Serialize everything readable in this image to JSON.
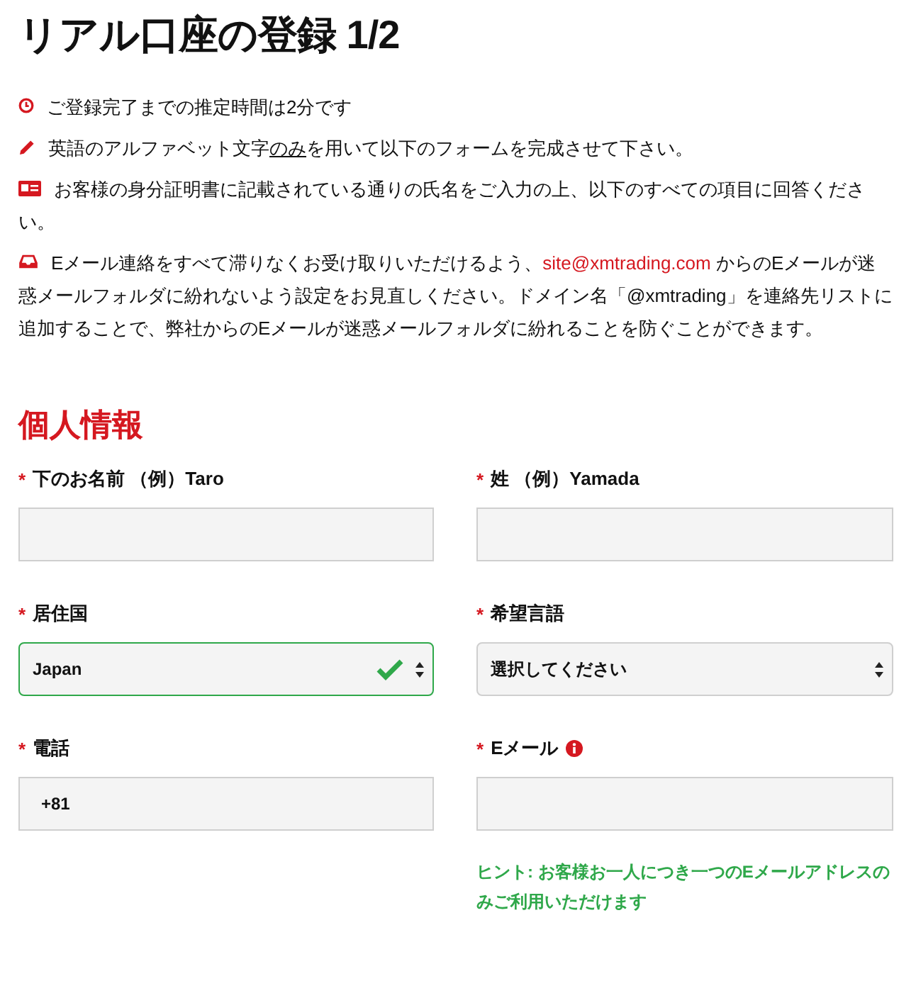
{
  "title": "リアル口座の登録 1/2",
  "notices": [
    {
      "parts": [
        {
          "text": "ご登録完了までの推定時間は2分です"
        }
      ]
    },
    {
      "parts": [
        {
          "text": "英語のアルファベット文字"
        },
        {
          "text": "のみ",
          "underline": true
        },
        {
          "text": "を用いて以下のフォームを完成させて下さい。"
        }
      ]
    },
    {
      "parts": [
        {
          "text": "お客様の身分証明書に記載されている通りの氏名をご入力の上、以下のすべての項目に回答ください。"
        }
      ]
    },
    {
      "parts": [
        {
          "text": "Eメール連絡をすべて滞りなくお受け取りいただけるよう、"
        },
        {
          "text": "site@xmtrading.com",
          "link": true
        },
        {
          "text": " からのEメールが迷惑メールフォルダに紛れないよう設定をお見直しください。ドメイン名「@xmtrading」を連絡先リストに追加することで、弊社からのEメールが迷惑メールフォルダに紛れることを防ぐことができます。"
        }
      ]
    }
  ],
  "section": {
    "title": "個人情報",
    "fields": [
      {
        "kind": "text",
        "mark": "*",
        "label": "下のお名前 （例）Taro"
      },
      {
        "kind": "text",
        "mark": "*",
        "label": "姓 （例）Yamada"
      },
      {
        "kind": "select",
        "mark": "*",
        "label": "居住国",
        "value": "Japan",
        "valid": true
      },
      {
        "kind": "select",
        "mark": "*",
        "label": "希望言語",
        "value": "選択してください",
        "valid": false
      },
      {
        "kind": "text",
        "mark": "*",
        "label": "電話",
        "value": "+81"
      },
      {
        "kind": "text",
        "mark": "*",
        "label": "Eメール",
        "info": true,
        "hint": "ヒント: お客様お一人につき一つのEメールアドレスのみご利用いただけます"
      }
    ]
  }
}
